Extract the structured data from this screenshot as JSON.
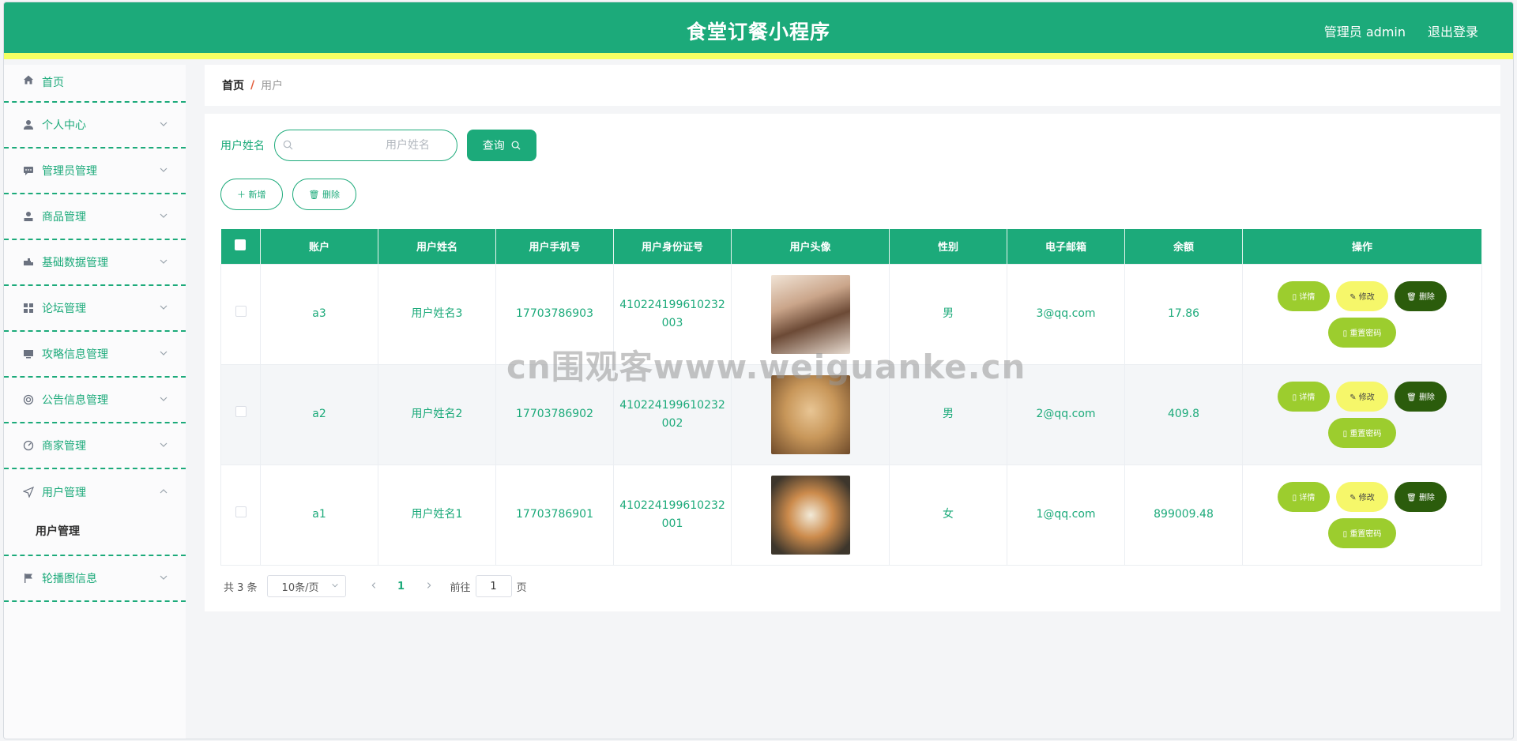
{
  "header": {
    "title": "食堂订餐小程序",
    "user": "管理员 admin",
    "logout": "退出登录"
  },
  "sidebar": {
    "items": [
      {
        "label": "首页",
        "icon": "home-icon"
      },
      {
        "label": "个人中心",
        "icon": "user-icon"
      },
      {
        "label": "管理员管理",
        "icon": "chat-icon"
      },
      {
        "label": "商品管理",
        "icon": "person-icon"
      },
      {
        "label": "基础数据管理",
        "icon": "truck-icon"
      },
      {
        "label": "论坛管理",
        "icon": "grid-icon"
      },
      {
        "label": "攻略信息管理",
        "icon": "monitor-icon"
      },
      {
        "label": "公告信息管理",
        "icon": "lifebuoy-icon"
      },
      {
        "label": "商家管理",
        "icon": "gauge-icon"
      },
      {
        "label": "用户管理",
        "icon": "send-icon"
      },
      {
        "label": "轮播图信息",
        "icon": "flag-icon"
      }
    ],
    "sub_item": "用户管理"
  },
  "breadcrumb": {
    "home": "首页",
    "separator": "/",
    "current": "用户"
  },
  "search": {
    "label": "用户姓名",
    "placeholder": "用户姓名",
    "button": "查询"
  },
  "actions": {
    "add": "新增",
    "delete": "删除"
  },
  "table": {
    "columns": [
      "账户",
      "用户姓名",
      "用户手机号",
      "用户身份证号",
      "用户头像",
      "性别",
      "电子邮箱",
      "余额",
      "操作"
    ],
    "rows": [
      {
        "account": "a3",
        "name": "用户姓名3",
        "phone": "17703786903",
        "id_line1": "410224199610232",
        "id_line2": "003",
        "gender": "男",
        "email": "3@qq.com",
        "balance": "17.86"
      },
      {
        "account": "a2",
        "name": "用户姓名2",
        "phone": "17703786902",
        "id_line1": "410224199610232",
        "id_line2": "002",
        "gender": "男",
        "email": "2@qq.com",
        "balance": "409.8"
      },
      {
        "account": "a1",
        "name": "用户姓名1",
        "phone": "17703786901",
        "id_line1": "410224199610232",
        "id_line2": "001",
        "gender": "女",
        "email": "1@qq.com",
        "balance": "899009.48"
      }
    ],
    "op_labels": {
      "detail": "详情",
      "edit": "修改",
      "delete": "删除",
      "reset": "重置密码"
    }
  },
  "pager": {
    "total": "共 3 条",
    "page_size": "10条/页",
    "current_page": "1",
    "goto_label": "前往",
    "goto_value": "1",
    "page_suffix": "页"
  },
  "watermark": "cn围观客www.weiguanke.cn",
  "colors": {
    "primary": "#1caa7a",
    "accent_bar": "#f4ff63",
    "detail": "#9ccd2e",
    "edit": "#f6f76a",
    "delete": "#2b5c0c"
  }
}
